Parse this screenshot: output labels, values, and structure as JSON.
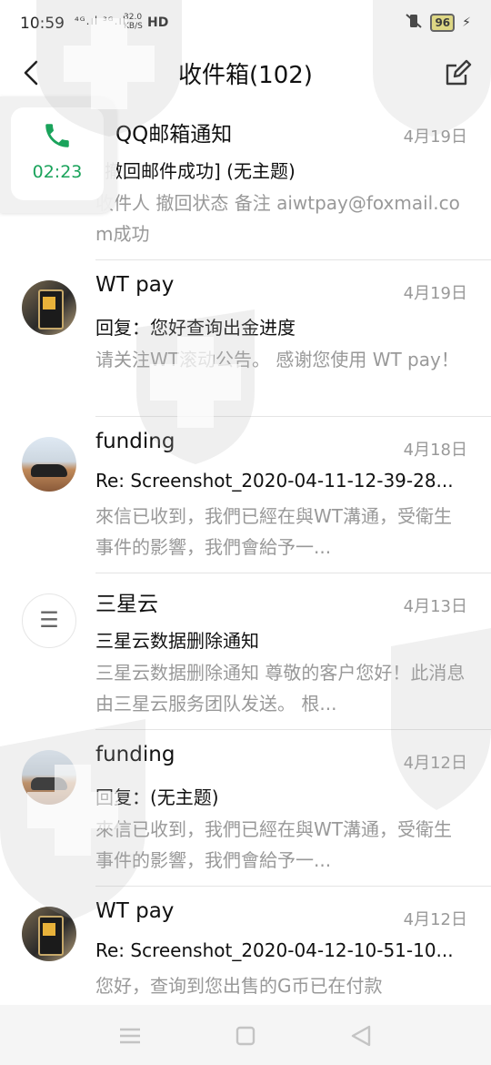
{
  "status_bar": {
    "time": "10:59",
    "signal": "⁴ᴳ.ıl ³ᴳ.ıl",
    "net_speed_value": "32.0",
    "net_speed_unit": "KB/S",
    "hd": "HD",
    "battery": "96"
  },
  "header": {
    "title": "收件箱(102)"
  },
  "call_bubble": {
    "duration": "02:23"
  },
  "mails": [
    {
      "sender": "QQ邮箱通知",
      "date": "4月19日",
      "subject": "撤回邮件成功] (无主题)",
      "preview": "收件人 撤回状态 备注 aiwtpay@foxmail.com成功",
      "avatar": "none"
    },
    {
      "sender": "WT pay",
      "date": "4月19日",
      "subject": "回复：您好查询出金进度",
      "preview": "请关注WT滚动公告。 感谢您使用 WT pay！",
      "avatar": "phone"
    },
    {
      "sender": "funding",
      "date": "4月18日",
      "subject": "Re: Screenshot_2020-04-11-12-39-28...",
      "preview": "來信已收到，我們已經在與WT溝通，受衛生事件的影響，我們會給予一...",
      "avatar": "car"
    },
    {
      "sender": "三星云",
      "date": "4月13日",
      "subject": "三星云数据删除通知",
      "preview": "三星云数据删除通知 尊敬的客户您好！此消息由三星云服务团队发送。 根...",
      "avatar": "menu"
    },
    {
      "sender": "funding",
      "date": "4月12日",
      "subject": "回复：(无主题)",
      "preview": "來信已收到，我們已經在與WT溝通，受衛生事件的影響，我們會給予一...",
      "avatar": "car"
    },
    {
      "sender": "WT pay",
      "date": "4月12日",
      "subject": "Re: Screenshot_2020-04-12-10-51-10...",
      "preview": "您好，查询到您出售的G币已在付款",
      "avatar": "phone"
    }
  ],
  "colors": {
    "accent_green": "#1aa35b",
    "muted_text": "#999999"
  },
  "icons": {
    "back": "back-arrow-icon",
    "compose": "compose-edit-icon",
    "call": "phone-call-icon",
    "menu_avatar": "three-lines-icon"
  }
}
